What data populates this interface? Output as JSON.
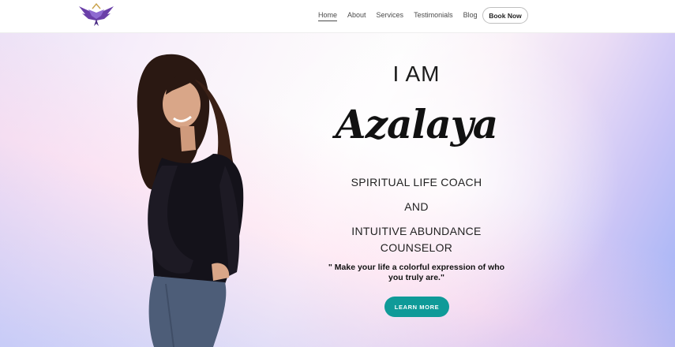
{
  "header": {
    "logo_icon": "phoenix-wings-logo",
    "nav": [
      {
        "label": "Home",
        "active": true
      },
      {
        "label": "About",
        "active": false
      },
      {
        "label": "Services",
        "active": false
      },
      {
        "label": "Testimonials",
        "active": false
      },
      {
        "label": "Blog",
        "active": false
      }
    ],
    "book_now": "Book Now"
  },
  "hero": {
    "intro": "I AM",
    "name": "Azalaya",
    "title_line1": "SPIRITUAL LIFE COACH",
    "title_and": "AND",
    "title_line2a": "INTUITIVE ABUNDANCE",
    "title_line2b": "COUNSELOR",
    "quote": "\" Make your life a colorful expression of who you truly are.\"",
    "cta": "LEARN MORE",
    "colors": {
      "cta_bg": "#0f9a98",
      "logo_purple": "#6a3fa8",
      "logo_gold": "#c9a24a"
    }
  }
}
